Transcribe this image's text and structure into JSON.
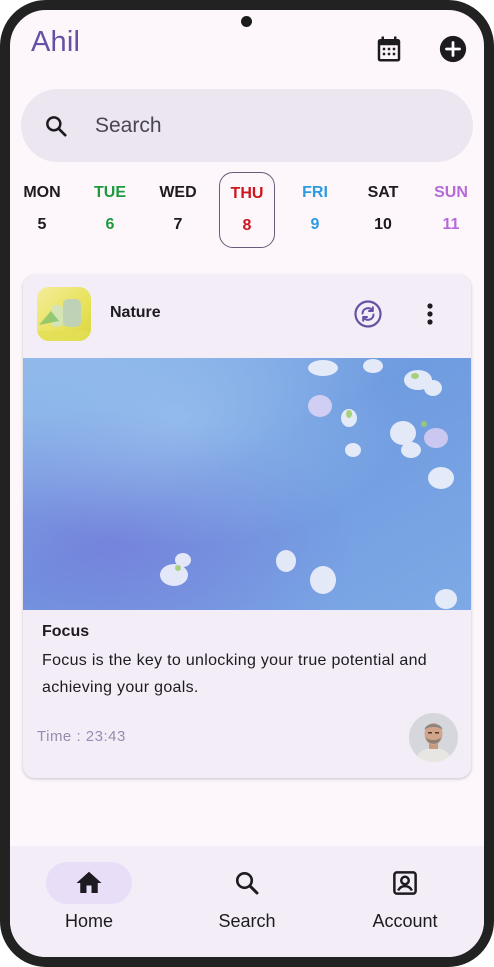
{
  "header": {
    "app_title": "Ahil",
    "calendar_icon": "calendar-icon",
    "add_icon": "add-circle-icon"
  },
  "search": {
    "placeholder": "Search",
    "icon": "search-icon"
  },
  "week": {
    "days": [
      {
        "name": "MON",
        "number": "5",
        "color": "#1d1b20"
      },
      {
        "name": "TUE",
        "number": "6",
        "color": "#1e9a3e"
      },
      {
        "name": "WED",
        "number": "7",
        "color": "#1d1b20"
      },
      {
        "name": "THU",
        "number": "8",
        "color": "#d0141e",
        "selected": true
      },
      {
        "name": "FRI",
        "number": "9",
        "color": "#2d9be0"
      },
      {
        "name": "SAT",
        "number": "10",
        "color": "#1d1b20"
      },
      {
        "name": "SUN",
        "number": "11",
        "color": "#b56ad8"
      }
    ]
  },
  "card": {
    "name": "Nature",
    "thumbnail_icon": "nature-thumbnail",
    "sync_icon": "sync-icon",
    "more_icon": "more-vert-icon",
    "heading": "Focus",
    "body": "Focus is the key to unlocking your true potential and achieving your goals.",
    "time_label": "Time : ",
    "time_value": "23:43"
  },
  "nav": {
    "items": [
      {
        "label": "Home",
        "icon": "home-icon",
        "active": true
      },
      {
        "label": "Search",
        "icon": "search-icon",
        "active": false
      },
      {
        "label": "Account",
        "icon": "account-box-icon",
        "active": false
      }
    ]
  },
  "colors": {
    "accent": "#6750a4",
    "background": "#fdf7fb",
    "surface": "#f3edf7",
    "nav_active_pill": "#e8def8"
  }
}
